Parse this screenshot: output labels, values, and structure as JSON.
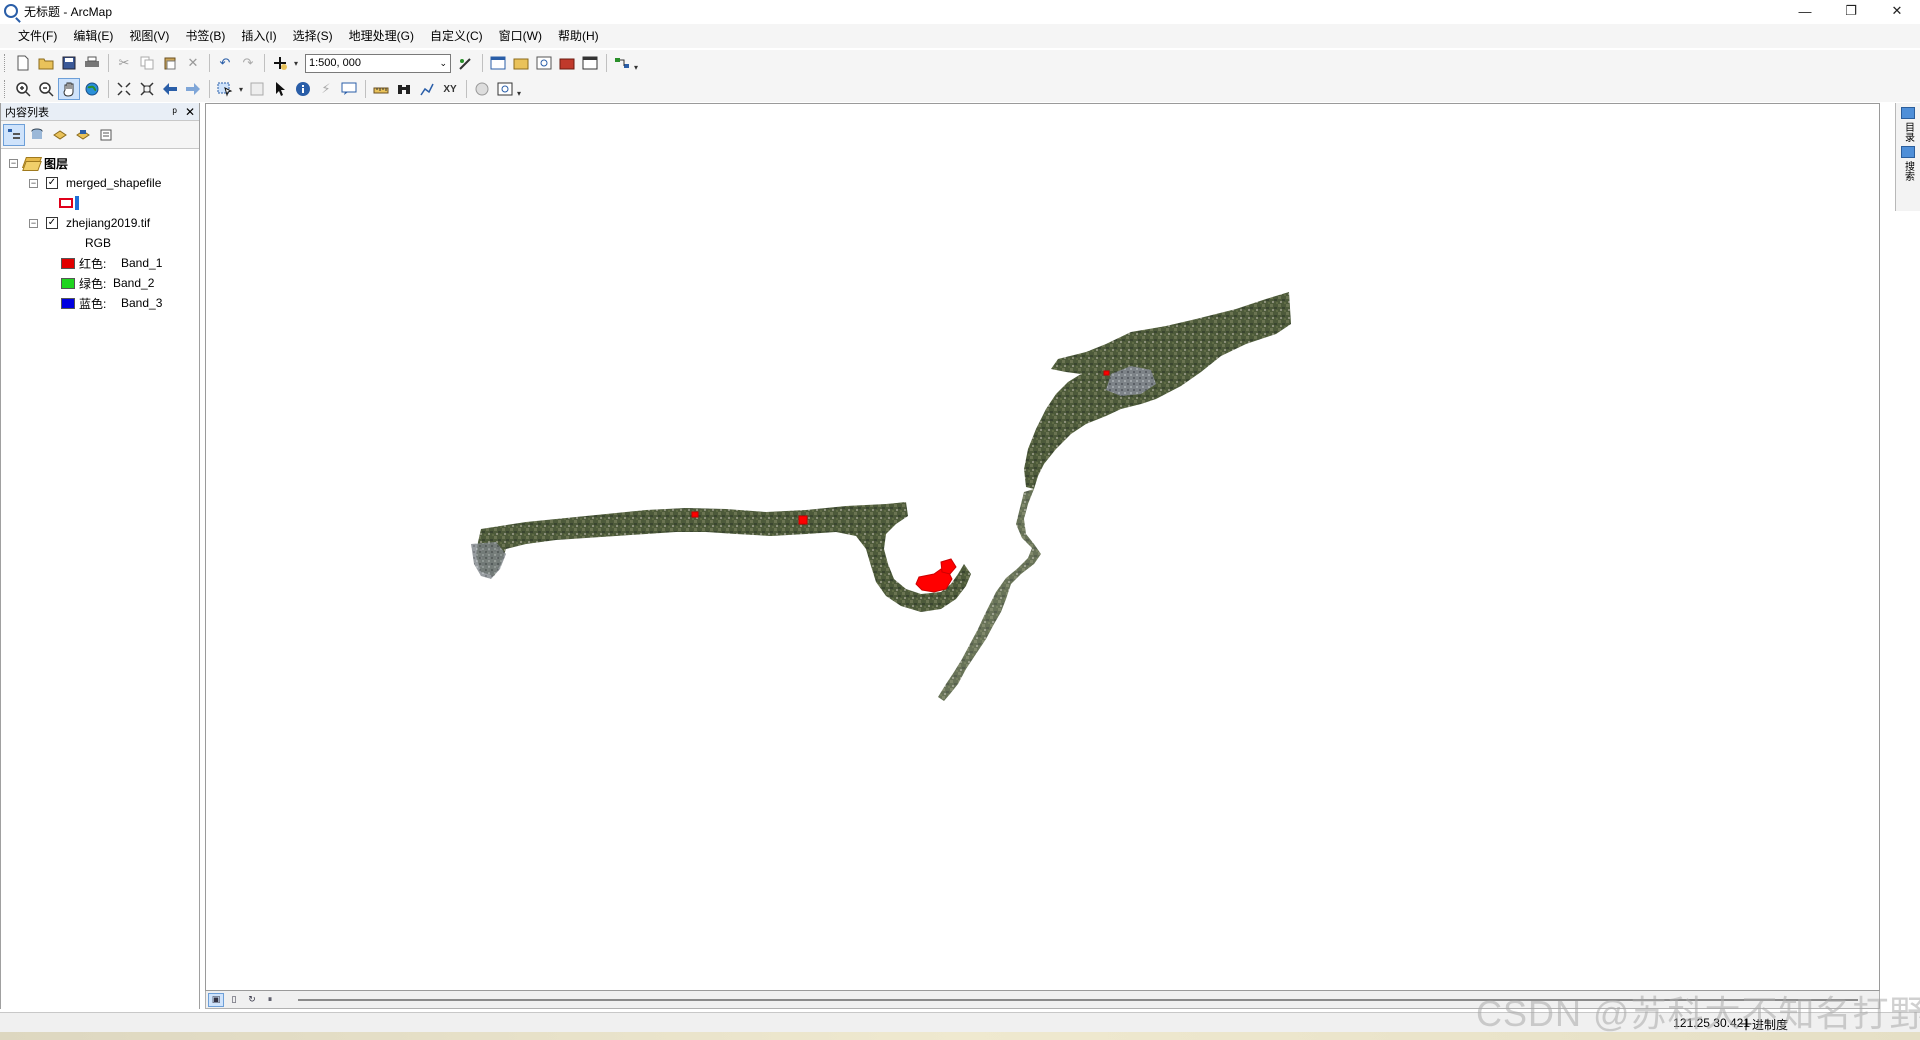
{
  "window": {
    "title": "无标题 - ArcMap",
    "minimize": "—",
    "restore": "❐",
    "close": "✕"
  },
  "menu": [
    "文件(F)",
    "编辑(E)",
    "视图(V)",
    "书签(B)",
    "插入(I)",
    "选择(S)",
    "地理处理(G)",
    "自定义(C)",
    "窗口(W)",
    "帮助(H)"
  ],
  "toolbar": {
    "scale_value": "1:500, 000"
  },
  "toc": {
    "title": "内容列表",
    "pin": "ᵖ",
    "close": "✕",
    "root": {
      "label": "图层",
      "expander": "−"
    },
    "layers": [
      {
        "label": "merged_shapefile",
        "checked": "✓",
        "expander": "−"
      },
      {
        "label": "zhejiang2019.tif",
        "checked": "✓",
        "expander": "−",
        "render": "RGB",
        "bands": [
          {
            "color_label": "红色:",
            "band": "Band_1",
            "color": "#e10000"
          },
          {
            "color_label": "绿色:",
            "band": "Band_2",
            "color": "#1fd41f"
          },
          {
            "color_label": "蓝色:",
            "band": "Band_3",
            "color": "#0000e0"
          }
        ]
      }
    ]
  },
  "right_dock": [
    {
      "label": "目录"
    },
    {
      "label": "搜索"
    }
  ],
  "status": {
    "coords": "121.25  30.421",
    "units": "十进制度"
  },
  "watermark": "CSDN @苏科大不知名打野",
  "colors": {
    "imagery": "#4f5a3c",
    "polygon": "#ff0000",
    "accent": "#2a5ea8"
  }
}
